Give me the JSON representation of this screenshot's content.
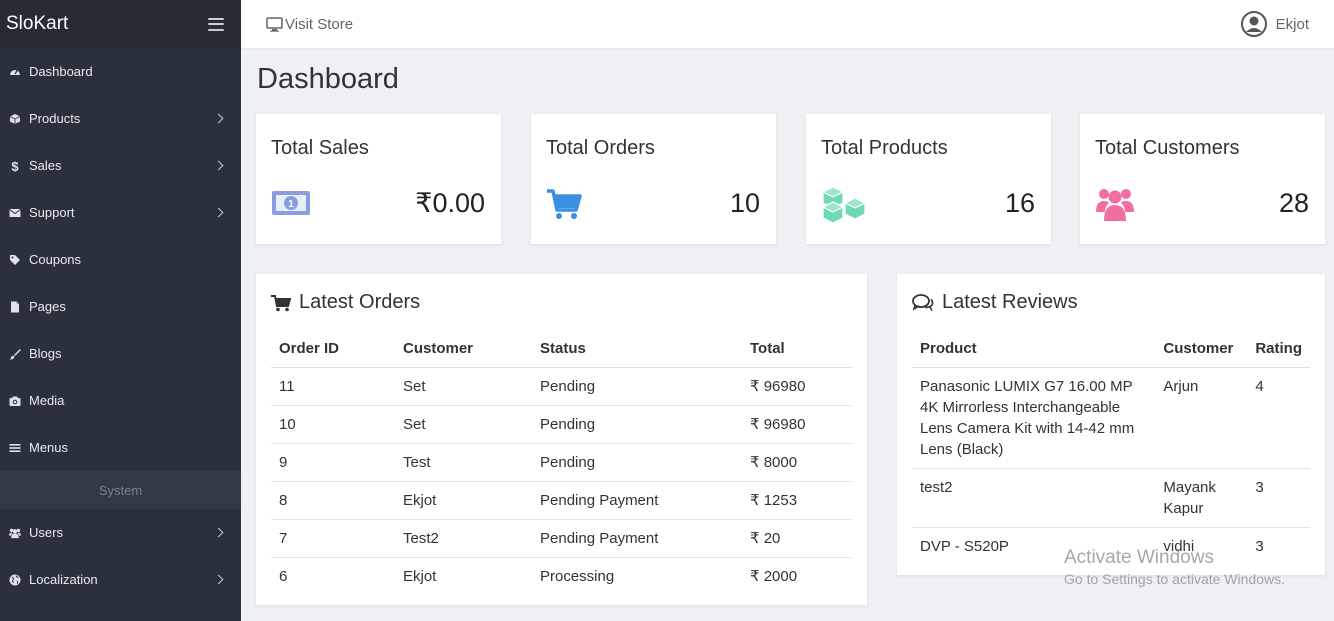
{
  "brand": "SloKart",
  "sidebar": {
    "items": [
      {
        "label": "Dashboard",
        "icon": "dashboard-icon",
        "has_children": false
      },
      {
        "label": "Products",
        "icon": "cube-icon",
        "has_children": true
      },
      {
        "label": "Sales",
        "icon": "dollar-icon",
        "has_children": true
      },
      {
        "label": "Support",
        "icon": "envelope-icon",
        "has_children": true
      },
      {
        "label": "Coupons",
        "icon": "tags-icon",
        "has_children": false
      },
      {
        "label": "Pages",
        "icon": "file-icon",
        "has_children": false
      },
      {
        "label": "Blogs",
        "icon": "brush-icon",
        "has_children": false
      },
      {
        "label": "Media",
        "icon": "camera-icon",
        "has_children": false
      },
      {
        "label": "Menus",
        "icon": "bars-icon",
        "has_children": false
      }
    ],
    "section": "System",
    "system_items": [
      {
        "label": "Users",
        "icon": "users-icon",
        "has_children": true
      },
      {
        "label": "Localization",
        "icon": "globe-icon",
        "has_children": true
      }
    ]
  },
  "topbar": {
    "visit_store": "Visit Store",
    "user_name": "Ekjot"
  },
  "page_title": "Dashboard",
  "stats": [
    {
      "title": "Total Sales",
      "value": "₹0.00",
      "icon": "money-bill-icon",
      "color": "#8b9ce0"
    },
    {
      "title": "Total Orders",
      "value": "10",
      "icon": "cart-icon",
      "color": "#3d8fe0"
    },
    {
      "title": "Total Products",
      "value": "16",
      "icon": "cubes-icon",
      "color": "#6fd8b8"
    },
    {
      "title": "Total Customers",
      "value": "28",
      "icon": "users-icon",
      "color": "#f16ea0"
    }
  ],
  "latest_orders": {
    "title": "Latest Orders",
    "columns": [
      "Order ID",
      "Customer",
      "Status",
      "Total"
    ],
    "rows": [
      [
        "11",
        "Set",
        "Pending",
        "₹ 96980"
      ],
      [
        "10",
        "Set",
        "Pending",
        "₹ 96980"
      ],
      [
        "9",
        "Test",
        "Pending",
        "₹ 8000"
      ],
      [
        "8",
        "Ekjot",
        "Pending Payment",
        "₹ 1253"
      ],
      [
        "7",
        "Test2",
        "Pending Payment",
        "₹ 20"
      ],
      [
        "6",
        "Ekjot",
        "Processing",
        "₹ 2000"
      ]
    ]
  },
  "latest_reviews": {
    "title": "Latest Reviews",
    "columns": [
      "Product",
      "Customer",
      "Rating"
    ],
    "rows": [
      [
        "Panasonic LUMIX G7 16.00 MP 4K Mirrorless Interchangeable Lens Camera Kit with 14-42 mm Lens (Black)",
        "Arjun",
        "4"
      ],
      [
        "test2",
        "Mayank Kapur",
        "3"
      ],
      [
        "DVP - S520P",
        "vidhi",
        "3"
      ]
    ]
  },
  "watermark": {
    "line1": "Activate Windows",
    "line2": "Go to Settings to activate Windows."
  }
}
